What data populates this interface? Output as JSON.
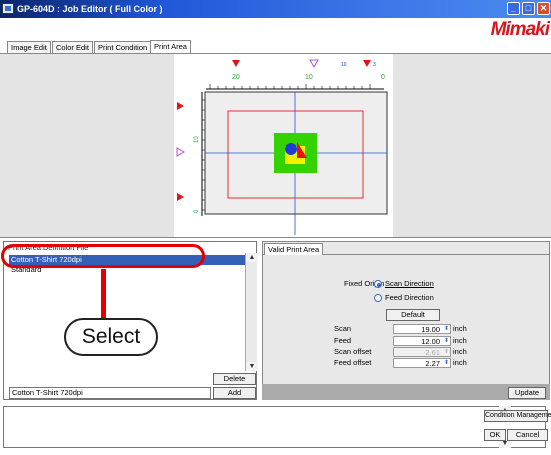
{
  "window": {
    "title": "GP-604D : Job Editor ( Full Color )",
    "brand": "Mimaki"
  },
  "tabs": [
    {
      "label": "Image Edit"
    },
    {
      "label": "Color Edit"
    },
    {
      "label": "Print Condition"
    },
    {
      "label": "Print Area"
    }
  ],
  "ruler": {
    "top_labels": [
      "20",
      "10",
      "0"
    ],
    "left_labels": [
      "10",
      "0"
    ],
    "markers": [
      "10",
      "3"
    ]
  },
  "file_panel": {
    "header": "Print Area Definition File",
    "items": [
      {
        "label": "Cotton T-Shirt 720dpi"
      },
      {
        "label": "Standard"
      }
    ],
    "delete_label": "Delete",
    "add_label": "Add",
    "selected_name": "Cotton T-Shirt 720dpi"
  },
  "valid_area": {
    "tab_label": "Valid Print Area",
    "fixed_origin_label": "Fixed Origin",
    "scan_direction_label": "Scan Direction",
    "feed_direction_label": "Feed Direction",
    "default_label": "Default",
    "fields": [
      {
        "label": "Scan",
        "value": "19.00",
        "unit": "inch"
      },
      {
        "label": "Feed",
        "value": "12.00",
        "unit": "inch"
      },
      {
        "label": "Scan offset",
        "value": "2.61",
        "unit": "inch"
      },
      {
        "label": "Feed offset",
        "value": "2.27",
        "unit": "inch"
      }
    ],
    "update_label": "Update"
  },
  "bottom": {
    "condition_management_label": "Condition Management",
    "ok_label": "OK",
    "cancel_label": "Cancel"
  },
  "annotation": {
    "select_label": "Select",
    "accent": "#e40000"
  },
  "colors": {
    "title_bar": "#0a246a",
    "selection": "#3560b8",
    "image_green": "#34d200",
    "image_yellow": "#f5f000",
    "image_blue": "#1e3cd2",
    "image_red": "#e41414"
  }
}
